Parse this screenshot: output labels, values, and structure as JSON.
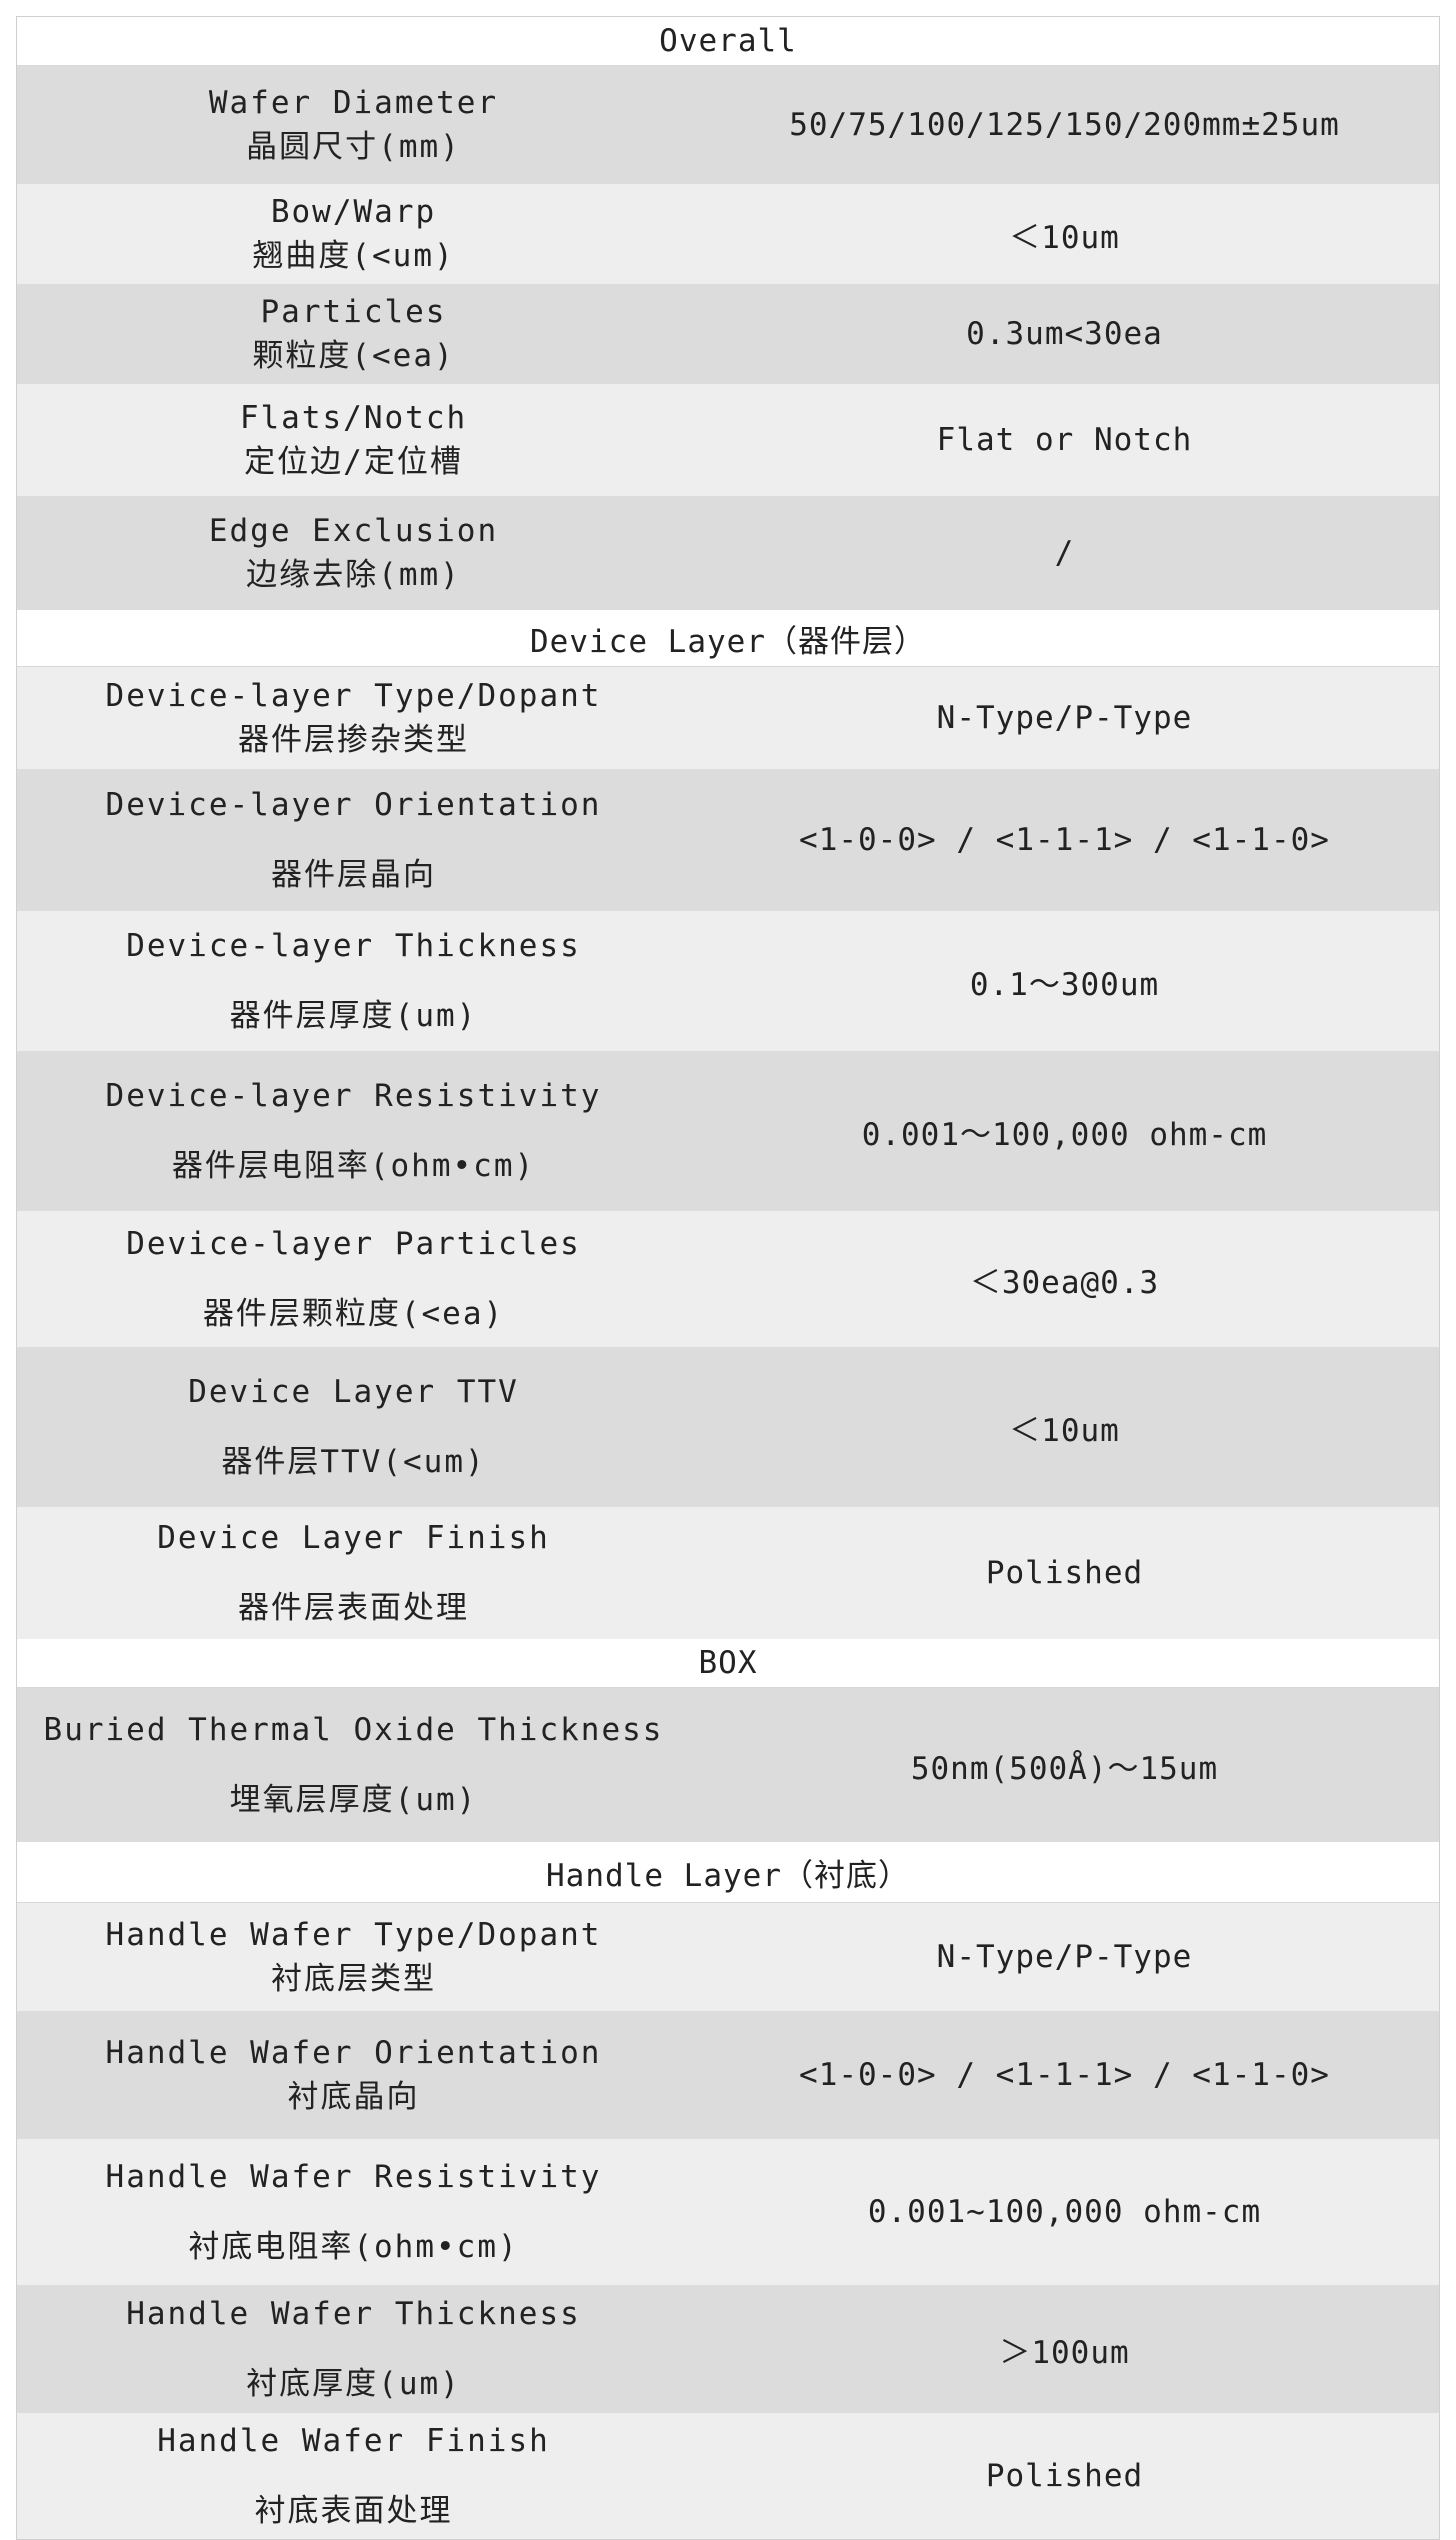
{
  "sections": [
    {
      "title": "Overall",
      "rows": [
        {
          "en": "Wafer Diameter",
          "cn": "晶圆尺寸(mm)",
          "value": "50/75/100/125/150/200mm±25um"
        },
        {
          "en": "Bow/Warp",
          "cn": "翘曲度(<um)",
          "value": "＜10um"
        },
        {
          "en": "Particles",
          "cn": "颗粒度(<ea)",
          "value": "0.3um<30ea"
        },
        {
          "en": "Flats/Notch",
          "cn": "定位边/定位槽",
          "value": "Flat or Notch"
        },
        {
          "en": "Edge Exclusion",
          "cn": "边缘去除(mm)",
          "value": "/"
        }
      ]
    },
    {
      "title": "Device Layer（器件层）",
      "rows": [
        {
          "en": "Device-layer Type/Dopant",
          "cn": "器件层掺杂类型",
          "value": "N-Type/P-Type"
        },
        {
          "en": "Device-layer Orientation",
          "cn": "器件层晶向",
          "value": "<1-0-0> / <1-1-1> / <1-1-0>"
        },
        {
          "en": "Device-layer Thickness",
          "cn": "器件层厚度(um)",
          "value": "0.1～300um"
        },
        {
          "en": "Device-layer Resistivity",
          "cn": "器件层电阻率(ohm•cm)",
          "value": "0.001～100,000 ohm-cm"
        },
        {
          "en": "Device-layer Particles",
          "cn": "器件层颗粒度(<ea)",
          "value": "＜30ea@0.3"
        },
        {
          "en": "Device Layer TTV",
          "cn": "器件层TTV(<um)",
          "value": "＜10um"
        },
        {
          "en": "Device Layer Finish",
          "cn": "器件层表面处理",
          "value": "Polished"
        }
      ]
    },
    {
      "title": "BOX",
      "rows": [
        {
          "en": "Buried Thermal Oxide Thickness",
          "cn": "埋氧层厚度(um)",
          "value": "50nm(500Å)～15um"
        }
      ]
    },
    {
      "title": "Handle Layer（衬底）",
      "rows": [
        {
          "en": "Handle Wafer Type/Dopant",
          "cn": "衬底层类型",
          "value": "N-Type/P-Type"
        },
        {
          "en": "Handle Wafer Orientation",
          "cn": "衬底晶向",
          "value": "<1-0-0> / <1-1-1> / <1-1-0>"
        },
        {
          "en": "Handle Wafer Resistivity",
          "cn": "衬底电阻率(ohm•cm)",
          "value": "0.001~100,000 ohm-cm"
        },
        {
          "en": "Handle Wafer Thickness",
          "cn": "衬底厚度(um)",
          "value": "＞100um"
        },
        {
          "en": "Handle Wafer Finish",
          "cn": "衬底表面处理",
          "value": "Polished"
        }
      ]
    }
  ]
}
